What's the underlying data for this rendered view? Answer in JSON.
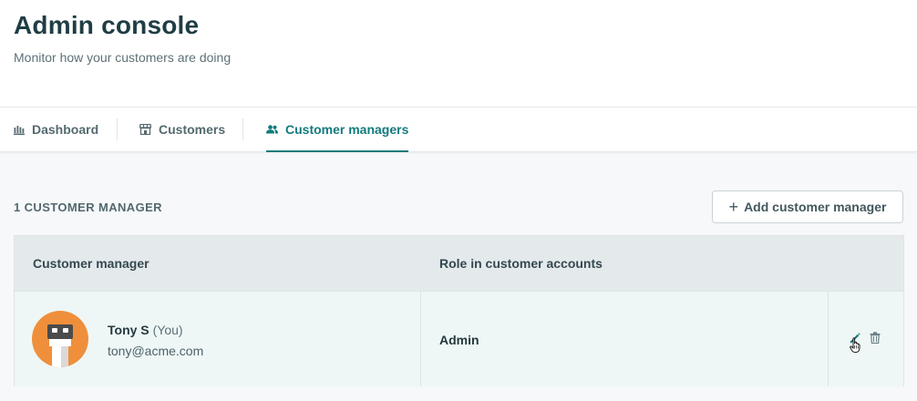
{
  "header": {
    "title": "Admin console",
    "subtitle": "Monitor how your customers are doing"
  },
  "tabs": [
    {
      "label": "Dashboard",
      "icon": "bar-chart-icon",
      "active": false
    },
    {
      "label": "Customers",
      "icon": "storefront-icon",
      "active": false
    },
    {
      "label": "Customer managers",
      "icon": "users-icon",
      "active": true
    }
  ],
  "section": {
    "title": "1 CUSTOMER MANAGER",
    "add_button_label": "Add customer manager"
  },
  "table": {
    "columns": [
      "Customer manager",
      "Role in customer accounts"
    ],
    "rows": [
      {
        "name": "Tony S",
        "you_label": "(You)",
        "email": "tony@acme.com",
        "role": "Admin"
      }
    ]
  },
  "colors": {
    "accent": "#127a7c",
    "avatar_bg": "#ef8f3c",
    "row_bg": "#eef7f6",
    "header_bg": "#e4e9eb"
  }
}
